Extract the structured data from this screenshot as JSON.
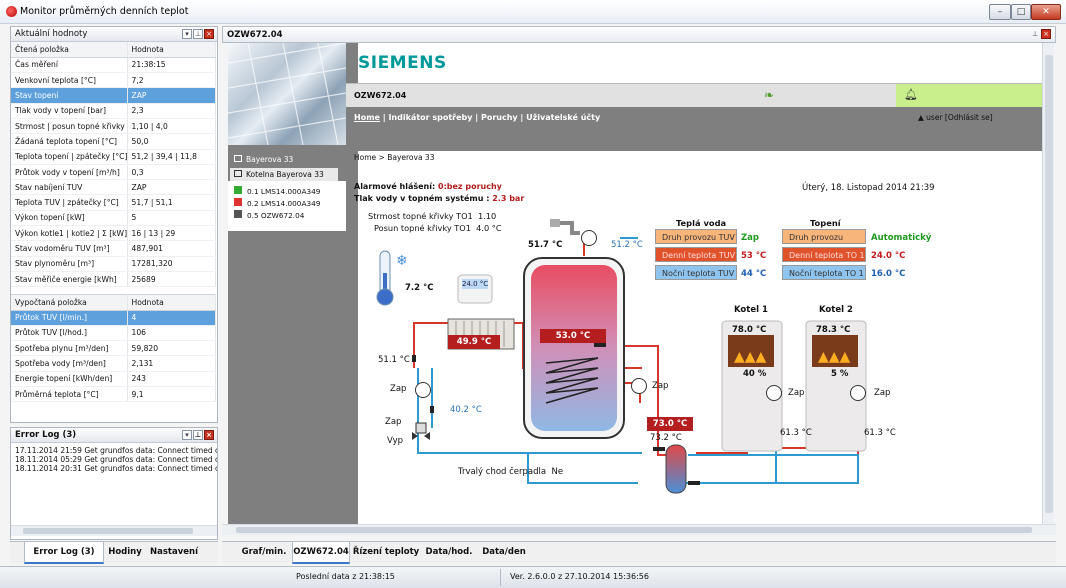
{
  "window": {
    "title": "Monitor průměrných denních teplot"
  },
  "left_panel": {
    "title": "Aktuální hodnoty",
    "col1": "Čtená položka",
    "col2": "Hodnota",
    "rows": [
      [
        "Čas měření",
        "21:38:15"
      ],
      [
        "Venkovní teplota [°C]",
        "7,2"
      ],
      [
        "Stav topení",
        "ZAP"
      ],
      [
        "Tlak vody v topení [bar]",
        "2,3"
      ],
      [
        "Strmost | posun topné křivky",
        "1,10 | 4,0"
      ],
      [
        "Žádaná teplota topení [°C]",
        "50,0"
      ],
      [
        "Teplota topení | zpátečky [°C]",
        "51,2 | 39,4 | 11,8"
      ],
      [
        "Průtok vody v topení [m³/h]",
        "0,3"
      ],
      [
        "Stav nabíjení TUV",
        "ZAP"
      ],
      [
        "Teplota TUV | zpátečky [°C]",
        "51,7 | 51,1"
      ],
      [
        "Výkon topení [kW]",
        "5"
      ],
      [
        "Výkon kotle1 | kotle2 | Σ [kW]",
        "16 | 13 | 29"
      ],
      [
        "Stav vodoměru TUV [m³]",
        "487,901"
      ],
      [
        "Stav plynoměru [m³]",
        "17281,320"
      ],
      [
        "Stav měřiče energie [kWh]",
        "25689"
      ]
    ],
    "selected_row": 2,
    "calc_col1": "Vypočtaná položka",
    "calc_col2": "Hodnota",
    "calc_rows": [
      [
        "Průtok TUV [l/min.]",
        "4"
      ],
      [
        "Průtok TUV [l/hod.]",
        "106"
      ],
      [
        "Spotřeba plynu [m³/den]",
        "59,820"
      ],
      [
        "Spotřeba vody [m³/den]",
        "2,131"
      ],
      [
        "Energie topení [kWh/den]",
        "243"
      ],
      [
        "Průměrná teplota [°C]",
        "9,1"
      ]
    ],
    "calc_selected_row": 0
  },
  "error_log": {
    "title": "Error Log (3)",
    "lines": [
      "17.11.2014 21:59 Get grundfos data: Connect timed ou",
      "18.11.2014 05:29 Get grundfos data: Connect timed ou",
      "18.11.2014 20:31 Get grundfos data: Connect timed ou"
    ]
  },
  "left_tabs": [
    "Error Log (3)",
    "Hodiny",
    "Nastavení"
  ],
  "doc": {
    "title": "OZW672.04"
  },
  "web": {
    "brand": "SIEMENS",
    "device": "OZW672.04",
    "nav": {
      "home": "Home",
      "rest": "| Indikátor spotřeby | Poruchy | Uživatelské účty"
    },
    "user": "user",
    "logout": "[Odhlásit se]",
    "sidebar": [
      "Bayerova 33",
      "Kotelna Bayerova 33"
    ],
    "tree": [
      "0.1 LMS14.000A349",
      "0.2 LMS14.000A349",
      "0.5 OZW672.04"
    ],
    "breadcrumb": "Home > Bayerova 33",
    "alarm_label": "Alarmové hlášení:",
    "alarm_value": "0:bez poruchy",
    "pressure_label": "Tlak vody v topném systému :",
    "pressure_value": "2.3 bar",
    "datetime": "Úterý, 18. Listopad 2014 21:39",
    "curve_slope_label": "Strmost topné křivky TO1",
    "curve_slope_value": "1.10",
    "curve_shift_label": "Posun topné křivky TO1",
    "curve_shift_value": "4.0 °C",
    "tuv_head": "Teplá voda",
    "heat_head": "Topení",
    "tuv_rows": [
      [
        "Druh provozu TUV",
        "Zap"
      ],
      [
        "Denní teplota TUV",
        "53 °C"
      ],
      [
        "Noční teplota TUV",
        "44 °C"
      ]
    ],
    "heat_rows": [
      [
        "Druh provozu topení",
        "Automatický"
      ],
      [
        "Denní teplota TO 1",
        "24.0 °C"
      ],
      [
        "Noční teplota TO 1",
        "16.0 °C"
      ]
    ],
    "outdoor_temp": "7.2 °C",
    "room_setpoint": "24.0 °C",
    "tap_temp": "51.7 °C",
    "tap_return": "51.2 °C",
    "tank_temp": "53.0 °C",
    "radiator_temp": "49.9 °C",
    "supply_temp": "51.1 °C",
    "return_temp": "40.2 °C",
    "zap1": "Zap",
    "zap2": "Zap",
    "zap3": "Zap",
    "zap_k1": "Zap",
    "zap_k2": "Zap",
    "valve_zap": "Zap",
    "valve_vyp": "Vyp",
    "hx_temp1": "73.0 °C",
    "hx_temp2": "73.2 °C",
    "circ_label": "Trvalý chod čerpadla",
    "circ_value": "Ne",
    "boiler1": {
      "name": "Kotel 1",
      "temp": "78.0 °C",
      "load": "40 %",
      "ret": "61.3 °C"
    },
    "boiler2": {
      "name": "Kotel 2",
      "temp": "78.3 °C",
      "load": "5 %",
      "ret": "61.3 °C"
    }
  },
  "bottom_tabs": [
    "Graf/min.",
    "OZW672.04",
    "Řízení teploty",
    "Data/hod.",
    "Data/den"
  ],
  "status": {
    "last": "Poslední data z 21:38:15",
    "version": "Ver. 2.6.0.0 z 27.10.2014 15:36:56"
  },
  "colors": {
    "hot": "#d7362a",
    "cold": "#2d9bd2",
    "siemens": "#009999",
    "selected": "#5ea0dc"
  }
}
